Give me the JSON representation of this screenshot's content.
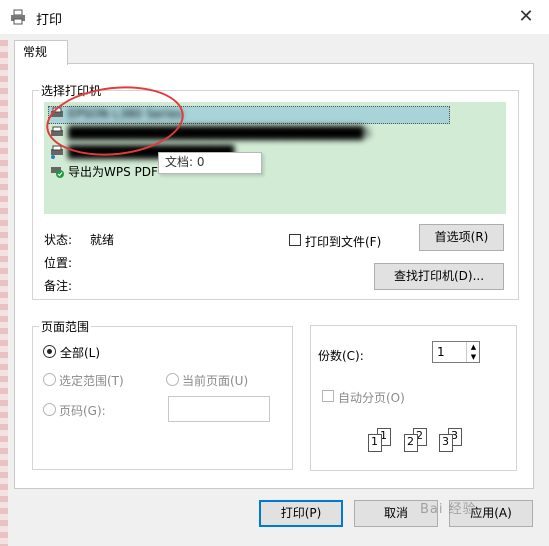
{
  "window": {
    "title": "打印",
    "close_glyph": "✕"
  },
  "tabs": [
    {
      "label": "常规"
    }
  ],
  "printer_section": {
    "legend": "选择打印机",
    "printers": [
      {
        "name": "EPSON L380 Series"
      },
      {
        "name": "████████████████████████████████S"
      },
      {
        "name": "██████████████████"
      },
      {
        "name": "导出为WPS PDF"
      }
    ],
    "tooltip": "文档: 0",
    "status_label": "状态:",
    "status_value": "就绪",
    "location_label": "位置:",
    "comment_label": "备注:",
    "print_to_file_label": "打印到文件(F)",
    "preferences_button": "首选项(R)",
    "find_printer_button": "查找打印机(D)..."
  },
  "page_range": {
    "legend": "页面范围",
    "all_label": "全部(L)",
    "selection_label": "选定范围(T)",
    "current_page_label": "当前页面(U)",
    "pages_label": "页码(G):",
    "pages_value": ""
  },
  "copies": {
    "label": "份数(C):",
    "value": "1",
    "collate_label": "自动分页(O)",
    "collate_pages": [
      "1",
      "1",
      "2",
      "2",
      "3",
      "3"
    ]
  },
  "footer": {
    "print_button": "打印(P)",
    "cancel_button": "取消",
    "apply_button": "应用(A)"
  },
  "watermark": "Bai 经验",
  "colors": {
    "list_bg": "#d1ebd5",
    "selection": "#a8d4d9",
    "annotation": "#e43a3a",
    "accent": "#0078d7"
  }
}
